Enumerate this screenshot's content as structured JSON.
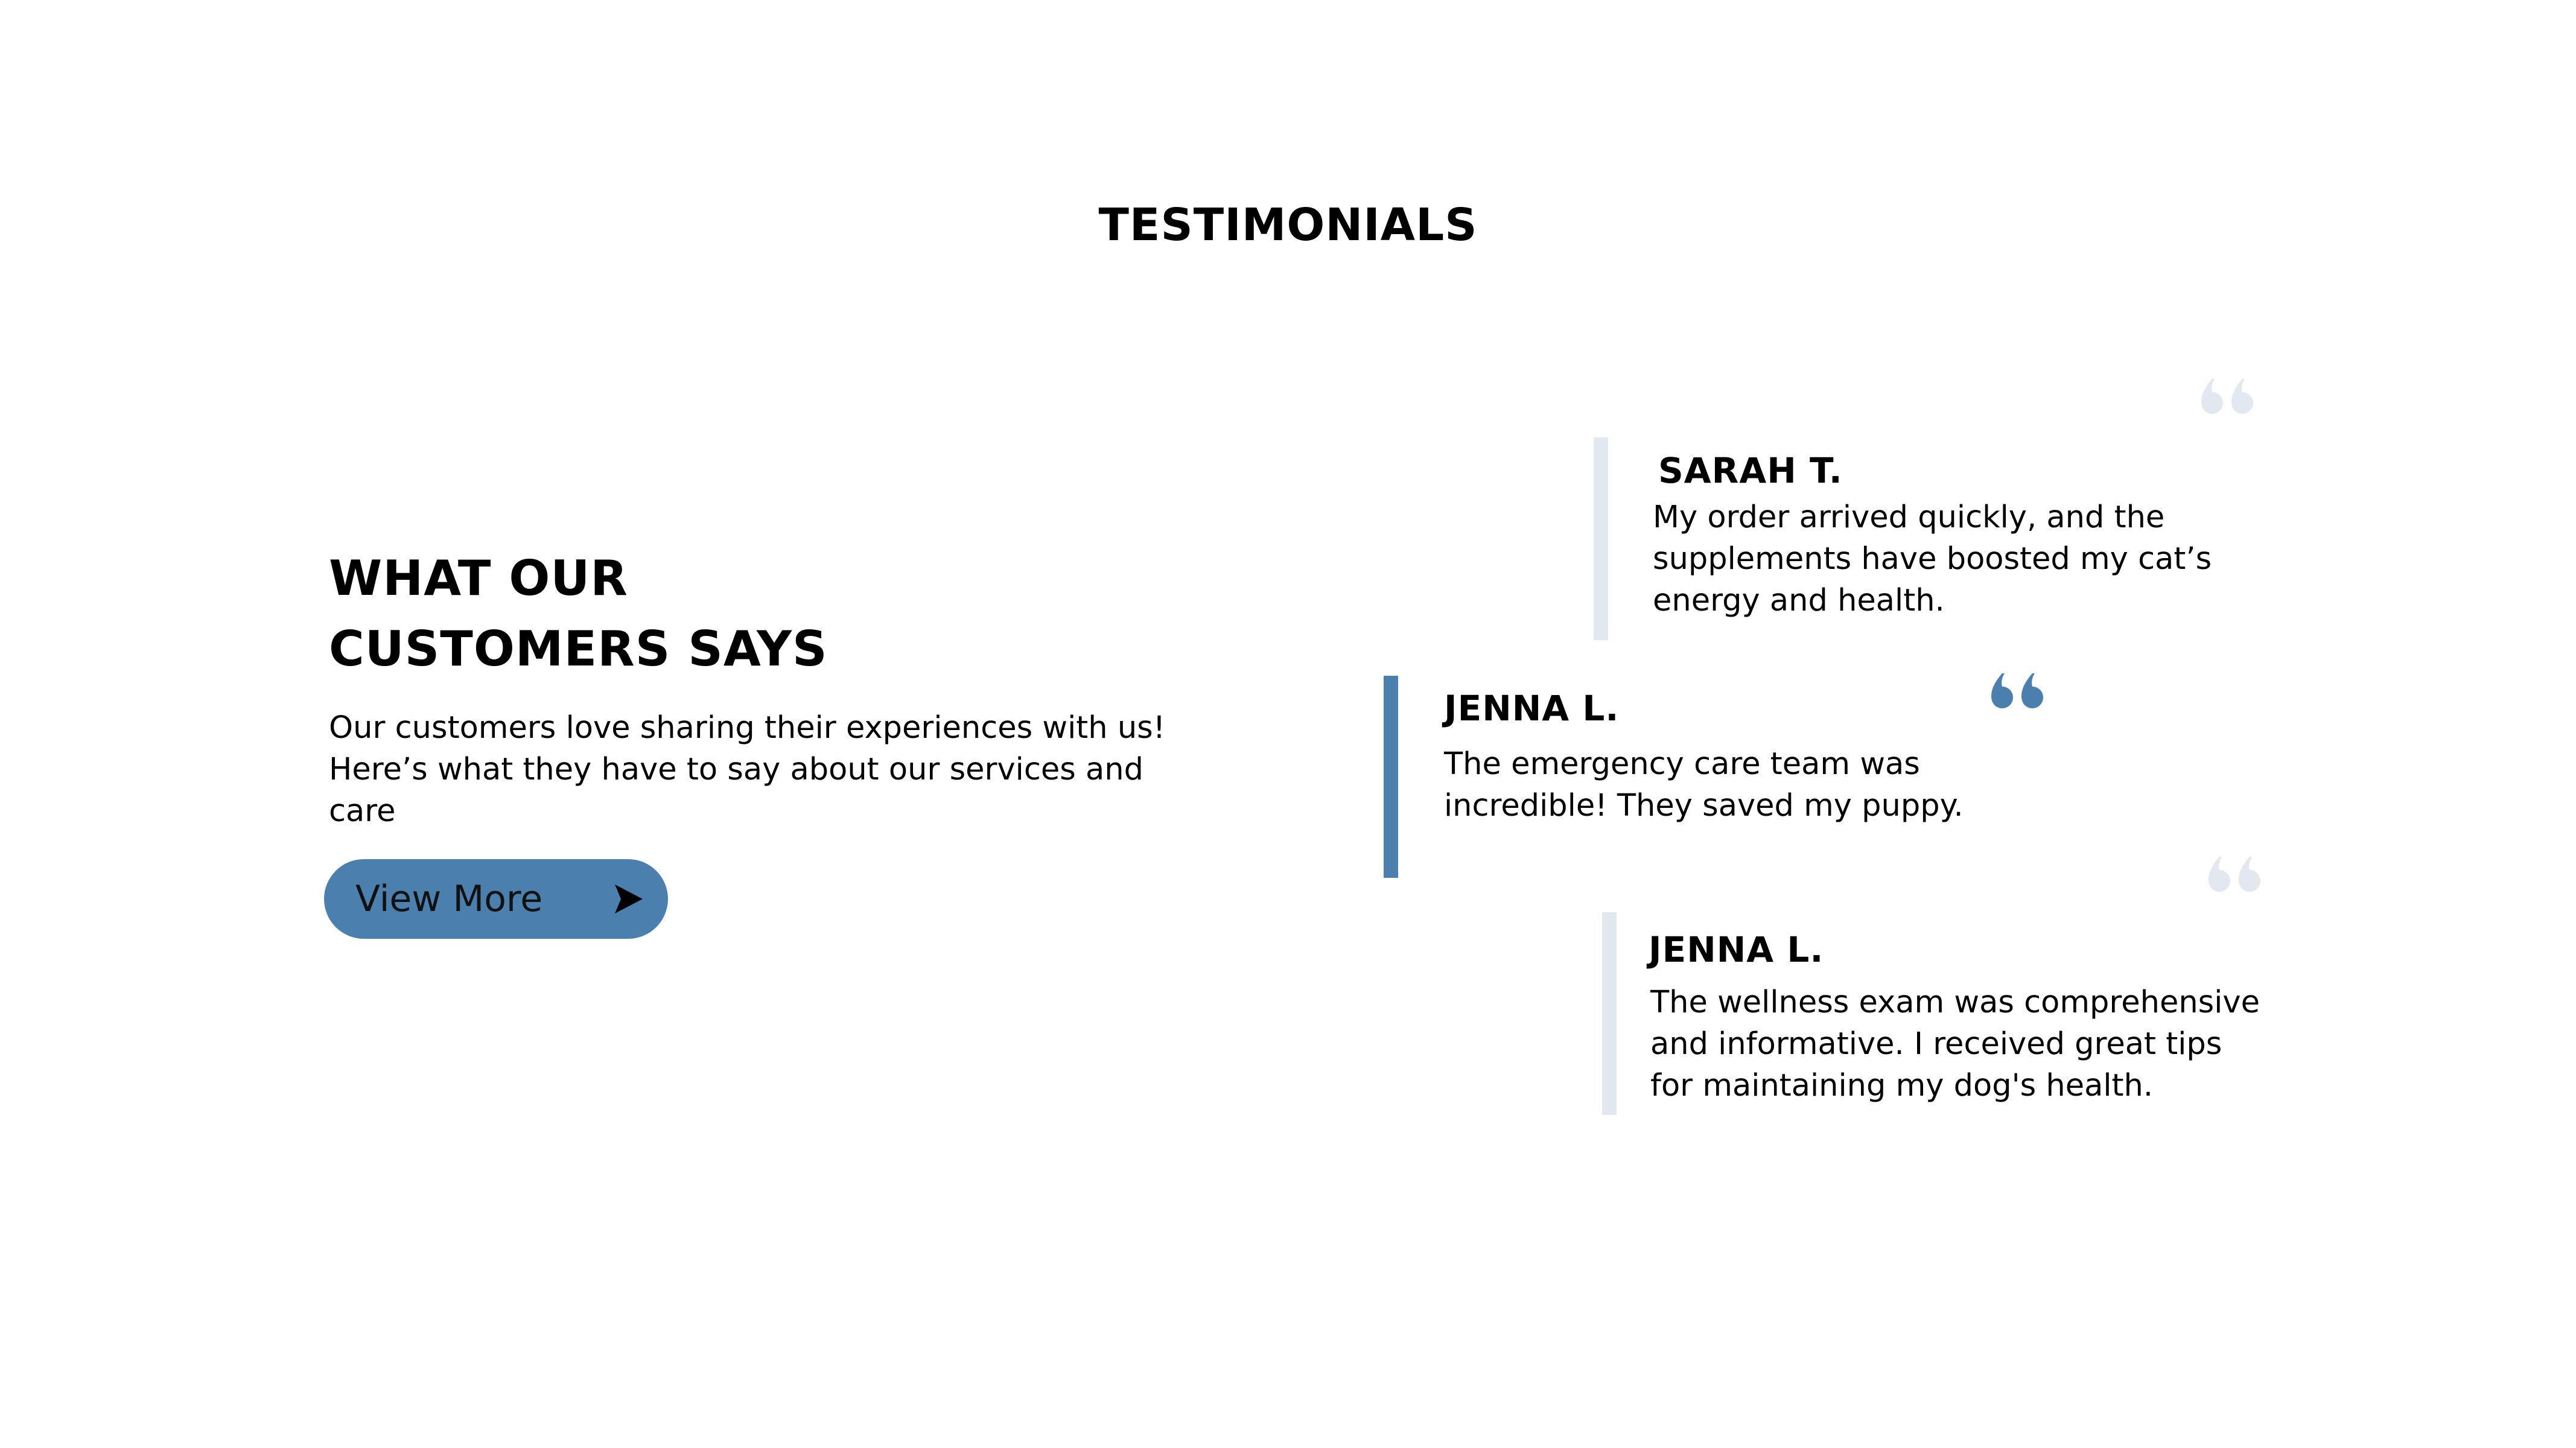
{
  "page": {
    "title": "TESTIMONIALS"
  },
  "intro": {
    "heading_line1": "WHAT OUR",
    "heading_line2": "CUSTOMERS SAYS",
    "text": "Our customers love sharing their experiences with us! Here’s what they have to say about our services and care",
    "button_label": "View More",
    "button_icon": "arrow-right-icon",
    "button_color": "#4a7fae"
  },
  "testimonials": [
    {
      "name": "SARAH T.",
      "text": "My order arrived quickly, and the supplements have boosted my cat’s energy and health.",
      "bar_color": "#e1e8ef",
      "quote_color": "#e1e8ef",
      "icon": "quote-icon",
      "highlighted": false
    },
    {
      "name": "JENNA L.",
      "text": "The emergency care team was incredible! They saved my puppy.",
      "bar_color": "#4a7fae",
      "quote_color": "#4a7fae",
      "icon": "quote-icon",
      "highlighted": true
    },
    {
      "name": "JENNA L.",
      "text": "The wellness exam was comprehensive and informative. I received great tips for maintaining my dog's health.",
      "bar_color": "#e1e8ef",
      "quote_color": "#e1e8ef",
      "icon": "quote-icon",
      "highlighted": false
    }
  ]
}
